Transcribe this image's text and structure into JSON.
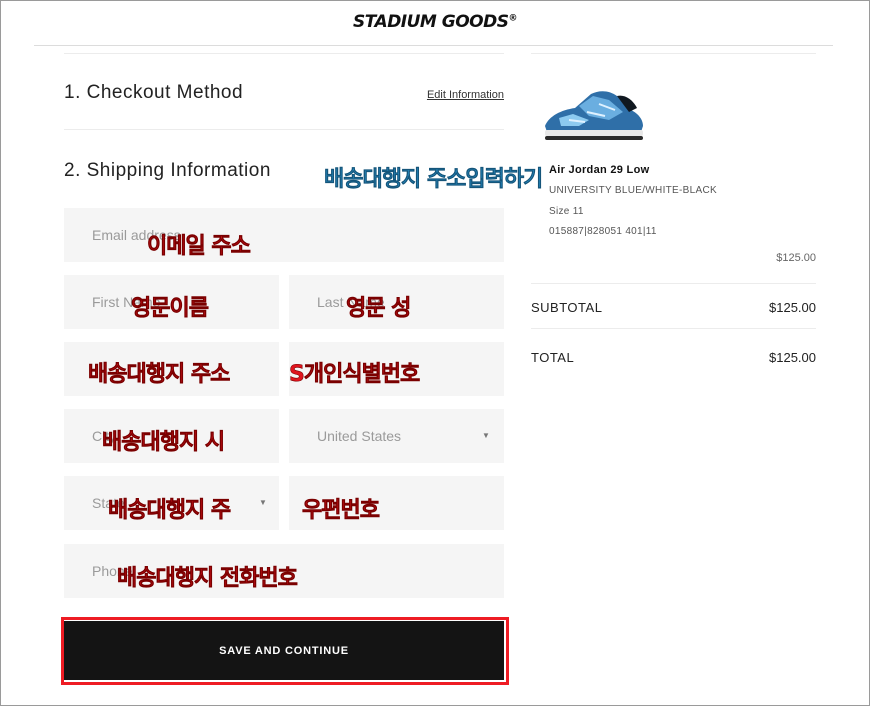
{
  "brand": {
    "name": "STADIUM GOODS",
    "mark": "®"
  },
  "checkout": {
    "step1": {
      "title": "1. Checkout Method",
      "edit_link": "Edit Information"
    },
    "step2": {
      "title": "2. Shipping Information"
    },
    "fields": {
      "email": "Email address",
      "first_name": "First Name",
      "last_name": "Last Name",
      "country": "United States",
      "city": "City",
      "state": "State",
      "phone": "Phone"
    },
    "button_label": "SAVE AND CONTINUE"
  },
  "annotations": {
    "shipping_heading": "배송대행지 주소입력하기",
    "email": "이메일 주소",
    "first_name": "영문이름",
    "last_name": "영문 성",
    "address": "배송대행지 주소",
    "personal_id": "S개인식별번호",
    "city": "배송대행지 시",
    "state": "배송대행지 주",
    "zip": "우편번호",
    "phone": "배송대행지 전화번호"
  },
  "order_summary": {
    "product_name": "Air Jordan 29 Low",
    "colorway": "UNIVERSITY BLUE/WHITE-BLACK",
    "size": "Size 11",
    "sku": "015887|828051 401|11",
    "item_price": "$125.00",
    "subtotal_label": "SUBTOTAL",
    "subtotal_value": "$125.00",
    "total_label": "TOTAL",
    "total_value": "$125.00"
  },
  "colors": {
    "annotation_red": "#e0141e",
    "annotation_blue": "#2b9bd8",
    "button_bg": "#141414",
    "highlight_border": "#ee1c24"
  }
}
